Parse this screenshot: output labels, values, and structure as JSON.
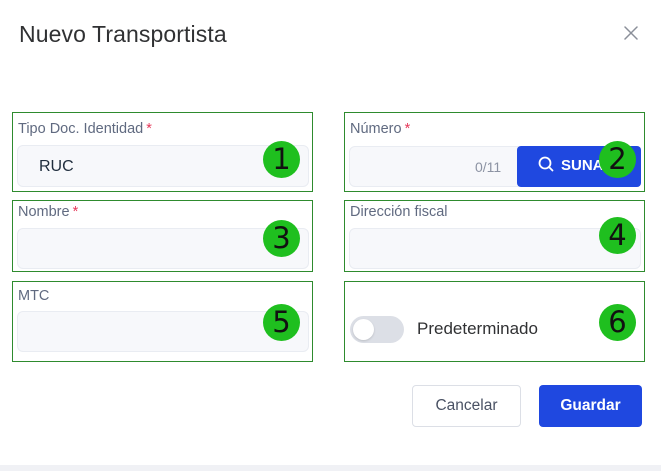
{
  "dialog": {
    "title": "Nuevo Transportista",
    "close_icon": "close-icon"
  },
  "fields": {
    "doc_type": {
      "label": "Tipo Doc. Identidad",
      "required_mark": "*",
      "value": "RUC"
    },
    "number": {
      "label": "Número",
      "required_mark": "*",
      "value": "",
      "counter": "0/11",
      "button_label": "SUNAT",
      "button_icon": "search-icon"
    },
    "name": {
      "label": "Nombre",
      "required_mark": "*",
      "value": ""
    },
    "address": {
      "label": "Dirección fiscal",
      "value": ""
    },
    "mtc": {
      "label": "MTC",
      "value": ""
    },
    "default": {
      "label": "Predeterminado",
      "enabled": false
    }
  },
  "annotations": [
    "1",
    "2",
    "3",
    "4",
    "5",
    "6"
  ],
  "footer": {
    "cancel_label": "Cancelar",
    "save_label": "Guardar"
  },
  "colors": {
    "primary": "#1f48e0",
    "required": "#e6395a",
    "annotation_border": "#2e8b2e",
    "annotation_badge": "#1fbf1f"
  }
}
